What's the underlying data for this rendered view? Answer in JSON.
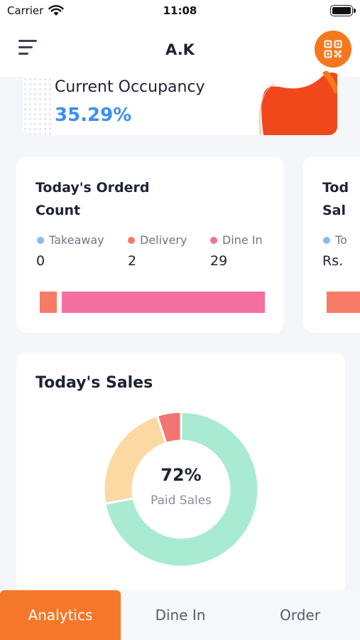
{
  "status_bar": {
    "carrier": "Carrier",
    "time": "11:08"
  },
  "header": {
    "title": "A.K",
    "menu_icon": "hamburger-menu-icon",
    "qr_icon": "qr-code-icon"
  },
  "occupancy": {
    "label": "Current Occupancy",
    "value": "35.29%"
  },
  "order_count": {
    "title_line1": "Today's Orderd",
    "title_line2": "Count",
    "items": [
      {
        "label": "Takeaway",
        "value": "0",
        "color": "#8ab9f5"
      },
      {
        "label": "Delivery",
        "value": "2",
        "color": "#f77b66"
      },
      {
        "label": "Dine In",
        "value": "29",
        "color": "#f56fa0"
      }
    ]
  },
  "next_card": {
    "title_line1": "Tod",
    "title_line2": "Sal",
    "legend_label": "To",
    "value": "Rs."
  },
  "sales": {
    "title": "Today's Sales",
    "center_value": "72%",
    "center_label": "Paid Sales"
  },
  "chart_data": {
    "type": "pie",
    "values": [
      72,
      23,
      5
    ],
    "colors": [
      "#a9ebd2",
      "#fcd9a3",
      "#f27572"
    ]
  },
  "bottom_nav": {
    "tabs": [
      "Analytics",
      "Dine In",
      "Order"
    ],
    "active": "Analytics"
  },
  "colors": {
    "accent": "#f5781f",
    "occupancy_value": "#3d8ef2"
  }
}
